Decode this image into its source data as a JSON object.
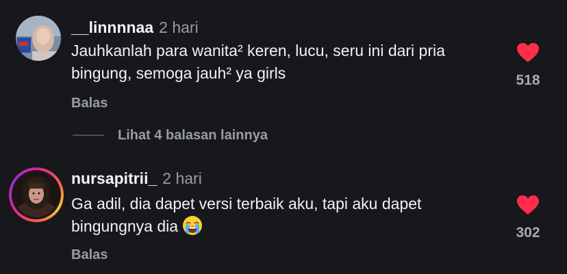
{
  "comments": [
    {
      "username": "__linnnnaa",
      "time": "2 hari",
      "text": "Jauhkanlah para wanita² keren, lucu, seru ini dari pria bingung, semoga jauh² ya girls",
      "likes": "518",
      "reply_label": "Balas",
      "liked": true
    },
    {
      "username": "nursapitrii_",
      "time": "2 hari",
      "text": "Ga adil, dia dapet versi terbaik aku, tapi aku dapet bingungnya dia",
      "emoji": "loudly-crying-face",
      "likes": "302",
      "reply_label": "Balas",
      "liked": true,
      "has_story_ring": true
    }
  ],
  "more_replies_label": "Lihat 4 balasan lainnya",
  "colors": {
    "background": "#16181b",
    "heart": "#ff2d4b",
    "muted": "#9a9da3"
  }
}
